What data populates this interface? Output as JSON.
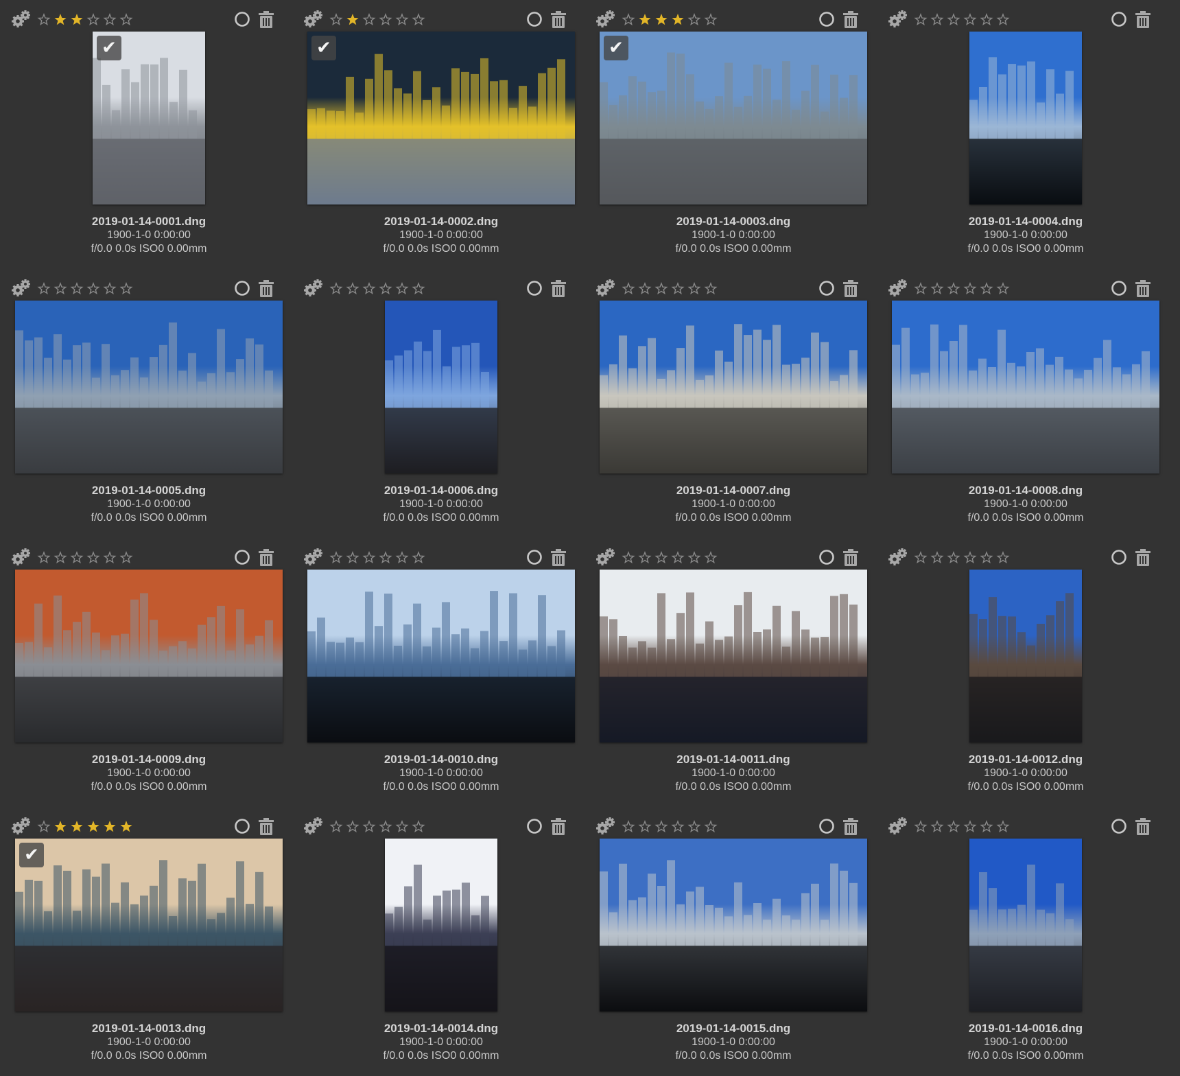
{
  "colors": {
    "background": "#333333",
    "star_on": "#e3b628",
    "star_off": "#8a8a8a",
    "icon": "#a8a8a8"
  },
  "photos": [
    {
      "filename": "2019-01-14-0001.dng",
      "date": "1900-1-0 0:00:00",
      "exif": "f/0.0 0.0s ISO0 0.00mm",
      "rating": 2,
      "selected": true,
      "orientation": "portrait",
      "palette": [
        "#d9dde3",
        "#8e939a",
        "#5f6268"
      ]
    },
    {
      "filename": "2019-01-14-0002.dng",
      "date": "1900-1-0 0:00:00",
      "exif": "f/0.0 0.0s ISO0 0.00mm",
      "rating": 1,
      "selected": true,
      "orientation": "landscape",
      "palette": [
        "#1b2a3a",
        "#e4c12a",
        "#6d7b8e"
      ]
    },
    {
      "filename": "2019-01-14-0003.dng",
      "date": "1900-1-0 0:00:00",
      "exif": "f/0.0 0.0s ISO0 0.00mm",
      "rating": 3,
      "selected": true,
      "orientation": "landscape",
      "palette": [
        "#6b95c9",
        "#7d8a92",
        "#55585c"
      ]
    },
    {
      "filename": "2019-01-14-0004.dng",
      "date": "1900-1-0 0:00:00",
      "exif": "f/0.0 0.0s ISO0 0.00mm",
      "rating": 0,
      "selected": false,
      "orientation": "portrait",
      "palette": [
        "#2f6fcf",
        "#9bb6d6",
        "#0a0d12"
      ]
    },
    {
      "filename": "2019-01-14-0005.dng",
      "date": "1900-1-0 0:00:00",
      "exif": "f/0.0 0.0s ISO0 0.00mm",
      "rating": 0,
      "selected": false,
      "orientation": "landscape",
      "palette": [
        "#2a63b8",
        "#8fa0b2",
        "#3a3c40"
      ]
    },
    {
      "filename": "2019-01-14-0006.dng",
      "date": "1900-1-0 0:00:00",
      "exif": "f/0.0 0.0s ISO0 0.00mm",
      "rating": 0,
      "selected": false,
      "orientation": "portrait",
      "palette": [
        "#2456b8",
        "#7ea5de",
        "#1e1e22"
      ]
    },
    {
      "filename": "2019-01-14-0007.dng",
      "date": "1900-1-0 0:00:00",
      "exif": "f/0.0 0.0s ISO0 0.00mm",
      "rating": 0,
      "selected": false,
      "orientation": "landscape",
      "palette": [
        "#2b67c2",
        "#c8c6be",
        "#3b3a36"
      ]
    },
    {
      "filename": "2019-01-14-0008.dng",
      "date": "1900-1-0 0:00:00",
      "exif": "f/0.0 0.0s ISO0 0.00mm",
      "rating": 0,
      "selected": false,
      "orientation": "landscape",
      "palette": [
        "#2d6ccc",
        "#a9b8c8",
        "#3c4046"
      ]
    },
    {
      "filename": "2019-01-14-0009.dng",
      "date": "1900-1-0 0:00:00",
      "exif": "f/0.0 0.0s ISO0 0.00mm",
      "rating": 0,
      "selected": false,
      "orientation": "landscape",
      "palette": [
        "#c25a2f",
        "#8b8e94",
        "#2a2b2e"
      ]
    },
    {
      "filename": "2019-01-14-0010.dng",
      "date": "1900-1-0 0:00:00",
      "exif": "f/0.0 0.0s ISO0 0.00mm",
      "rating": 0,
      "selected": false,
      "orientation": "landscape",
      "palette": [
        "#bcd2ea",
        "#4a6d98",
        "#0b0d12"
      ]
    },
    {
      "filename": "2019-01-14-0011.dng",
      "date": "1900-1-0 0:00:00",
      "exif": "f/0.0 0.0s ISO0 0.00mm",
      "rating": 0,
      "selected": false,
      "orientation": "landscape",
      "palette": [
        "#e8ecef",
        "#5b4a44",
        "#161a26"
      ]
    },
    {
      "filename": "2019-01-14-0012.dng",
      "date": "1900-1-0 0:00:00",
      "exif": "f/0.0 0.0s ISO0 0.00mm",
      "rating": 0,
      "selected": false,
      "orientation": "portrait",
      "palette": [
        "#2c63c4",
        "#5a4a40",
        "#1a1a1c"
      ]
    },
    {
      "filename": "2019-01-14-0013.dng",
      "date": "1900-1-0 0:00:00",
      "exif": "f/0.0 0.0s ISO0 0.00mm",
      "rating": 5,
      "selected": true,
      "orientation": "landscape",
      "palette": [
        "#dcc6a8",
        "#3d5666",
        "#2a2424"
      ]
    },
    {
      "filename": "2019-01-14-0014.dng",
      "date": "1900-1-0 0:00:00",
      "exif": "f/0.0 0.0s ISO0 0.00mm",
      "rating": 0,
      "selected": false,
      "orientation": "portrait",
      "palette": [
        "#f0f2f6",
        "#3c3f55",
        "#15141a"
      ]
    },
    {
      "filename": "2019-01-14-0015.dng",
      "date": "1900-1-0 0:00:00",
      "exif": "f/0.0 0.0s ISO0 0.00mm",
      "rating": 0,
      "selected": false,
      "orientation": "landscape",
      "palette": [
        "#3d6fc4",
        "#b9c2cc",
        "#0c0d10"
      ]
    },
    {
      "filename": "2019-01-14-0016.dng",
      "date": "1900-1-0 0:00:00",
      "exif": "f/0.0 0.0s ISO0 0.00mm",
      "rating": 0,
      "selected": false,
      "orientation": "portrait",
      "palette": [
        "#2159c6",
        "#8ea0b8",
        "#1d1f24"
      ]
    }
  ],
  "icons": {
    "gear": "gear-icon",
    "star": "star-icon",
    "reject": "reject-circle-icon",
    "trash": "trash-icon",
    "check": "checkmark-icon"
  },
  "check_glyph": "✔"
}
